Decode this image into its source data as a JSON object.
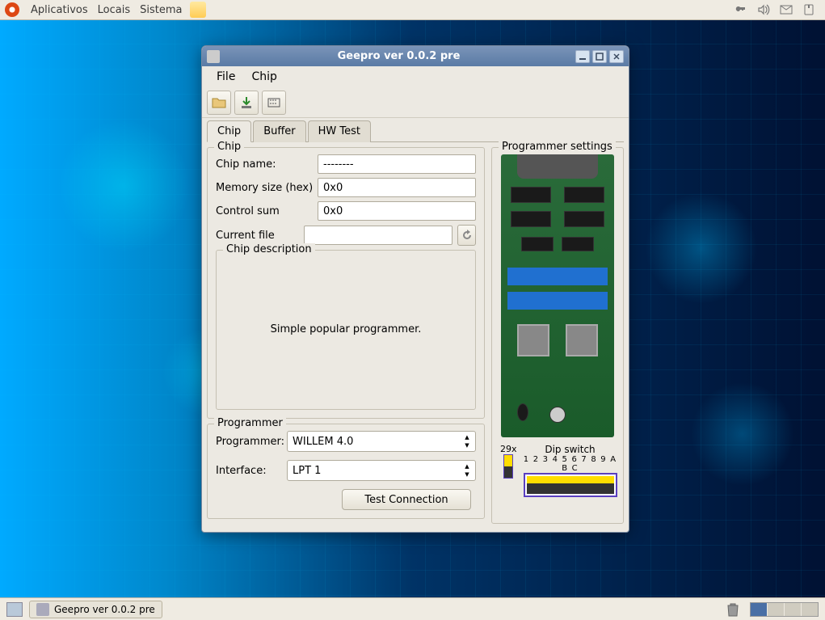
{
  "top_menu": {
    "apps": "Aplicativos",
    "places": "Locais",
    "system": "Sistema"
  },
  "taskbar": {
    "window_title": "Geepro ver 0.0.2 pre"
  },
  "window": {
    "title": "Geepro ver 0.0.2 pre",
    "menu": {
      "file": "File",
      "chip": "Chip"
    },
    "tabs": {
      "chip": "Chip",
      "buffer": "Buffer",
      "hwtest": "HW Test"
    },
    "chip_group": {
      "legend": "Chip",
      "name_label": "Chip name:",
      "name_value": "--------",
      "mem_label": "Memory size (hex)",
      "mem_value": "0x0",
      "sum_label": "Control sum",
      "sum_value": "0x0",
      "file_label": "Current file",
      "file_value": ""
    },
    "desc_group": {
      "legend": "Chip description",
      "text": "Simple popular programmer."
    },
    "prog_group": {
      "legend": "Programmer",
      "prog_label": "Programmer:",
      "prog_value": "WILLEM 4.0",
      "iface_label": "Interface:",
      "iface_value": "LPT 1",
      "test_btn": "Test Connection"
    },
    "settings_group": {
      "legend": "Programmer settings",
      "jumper_label": "29x",
      "dip_label": "Dip switch",
      "dip_nums": "1 2 3 4 5 6 7 8 9 A B C"
    }
  }
}
